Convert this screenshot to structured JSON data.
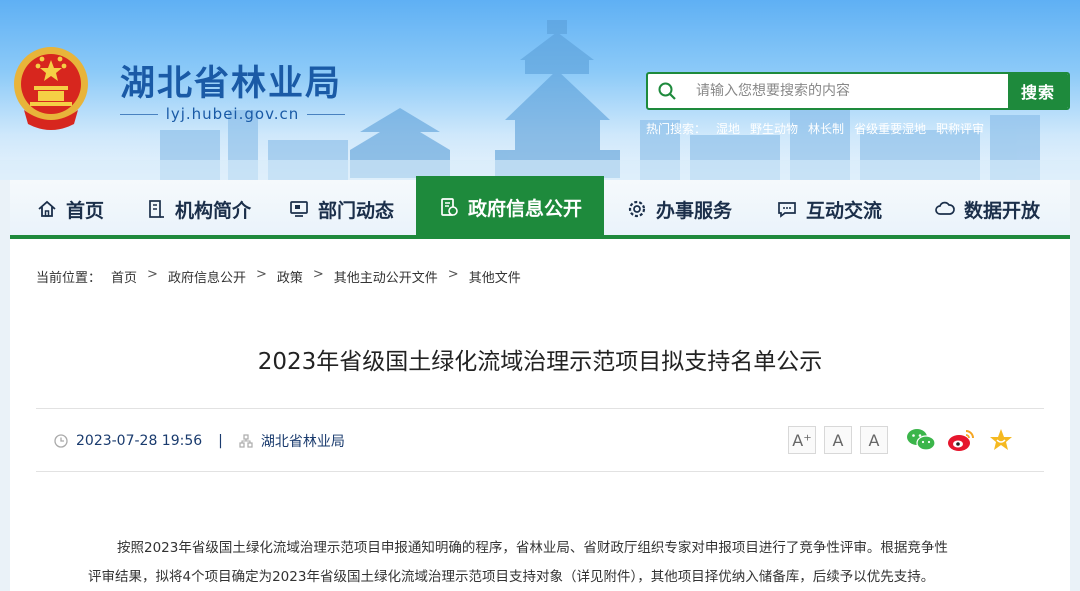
{
  "header": {
    "site_title": "湖北省林业局",
    "site_domain": "lyj.hubei.gov.cn",
    "search": {
      "placeholder": "请输入您想要搜索的内容",
      "button_label": "搜索"
    },
    "hot_search": {
      "label": "热门搜索：",
      "items": [
        "湿地",
        "野生动物",
        "林长制",
        "省级重要湿地",
        "职称评审"
      ]
    }
  },
  "nav": {
    "items": [
      {
        "label": "首页",
        "icon": "home-icon"
      },
      {
        "label": "机构简介",
        "icon": "building-icon"
      },
      {
        "label": "部门动态",
        "icon": "monitor-icon"
      },
      {
        "label": "政府信息公开",
        "icon": "document-icon",
        "active": true
      },
      {
        "label": "办事服务",
        "icon": "gear-icon"
      },
      {
        "label": "互动交流",
        "icon": "chat-icon"
      },
      {
        "label": "数据开放",
        "icon": "cloud-icon"
      }
    ],
    "accent": "#1e8a3c"
  },
  "breadcrumb": {
    "label": "当前位置：",
    "items": [
      "首页",
      "政府信息公开",
      "政策",
      "其他主动公开文件",
      "其他文件"
    ]
  },
  "article": {
    "title": "2023年省级国土绿化流域治理示范项目拟支持名单公示",
    "date": "2023-07-28 19:56",
    "meta_separator": "|",
    "source": "湖北省林业局",
    "font_sizes": [
      "A⁺",
      "A",
      "A"
    ],
    "share": [
      "wechat-icon",
      "weibo-icon",
      "favorite-icon"
    ],
    "paragraph_1": "按照2023年省级国土绿化流域治理示范项目申报通知明确的程序，省林业局、省财政厅组织专家对申报项目进行了竞争性评审。根据竞争性",
    "paragraph_2": "评审结果，拟将4个项目确定为2023年省级国土绿化流域治理示范项目支持对象（详见附件），其他项目择优纳入储备库，后续予以优先支持。"
  }
}
